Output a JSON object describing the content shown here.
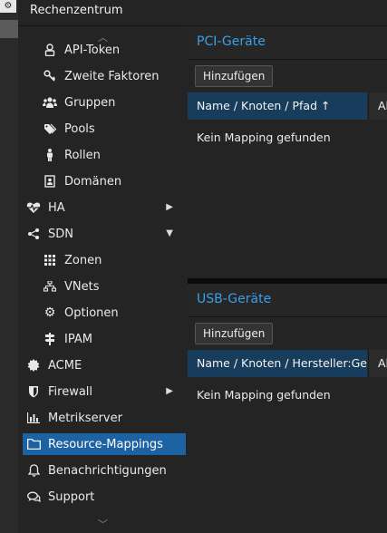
{
  "header": {
    "title": "Rechenzentrum"
  },
  "nav": {
    "items": [
      {
        "label": "API-Token",
        "icon": "user-icon"
      },
      {
        "label": "Zweite Faktoren",
        "icon": "key-icon"
      },
      {
        "label": "Gruppen",
        "icon": "users-icon"
      },
      {
        "label": "Pools",
        "icon": "tags-icon"
      },
      {
        "label": "Rollen",
        "icon": "male-icon"
      },
      {
        "label": "Domänen",
        "icon": "address-book-icon"
      },
      {
        "label": "HA",
        "icon": "heartbeat-icon"
      },
      {
        "label": "SDN",
        "icon": "sdn-icon"
      },
      {
        "label": "Zonen",
        "icon": "grid-icon"
      },
      {
        "label": "VNets",
        "icon": "network-icon"
      },
      {
        "label": "Optionen",
        "icon": "gear-icon"
      },
      {
        "label": "IPAM",
        "icon": "signpost-icon"
      },
      {
        "label": "ACME",
        "icon": "certificate-icon"
      },
      {
        "label": "Firewall",
        "icon": "shield-icon"
      },
      {
        "label": "Metrikserver",
        "icon": "bar-chart-icon"
      },
      {
        "label": "Resource-Mappings",
        "icon": "folder-icon"
      },
      {
        "label": "Benachrichtigungen",
        "icon": "bell-icon"
      },
      {
        "label": "Support",
        "icon": "comments-icon"
      }
    ]
  },
  "pci": {
    "title": "PCI-Geräte",
    "add_label": "Hinzufügen",
    "col1": "Name / Knoten / Pfad ↑",
    "col2": "Al",
    "empty": "Kein Mapping gefunden"
  },
  "usb": {
    "title": "USB-Geräte",
    "add_label": "Hinzufügen",
    "col1": "Name / Knoten / Hersteller:Gerät",
    "col2": "Al",
    "empty": "Kein Mapping gefunden"
  },
  "colors": {
    "accent": "#1d63a3",
    "title": "#3aa0e8",
    "sorted_header": "#173c5c"
  }
}
